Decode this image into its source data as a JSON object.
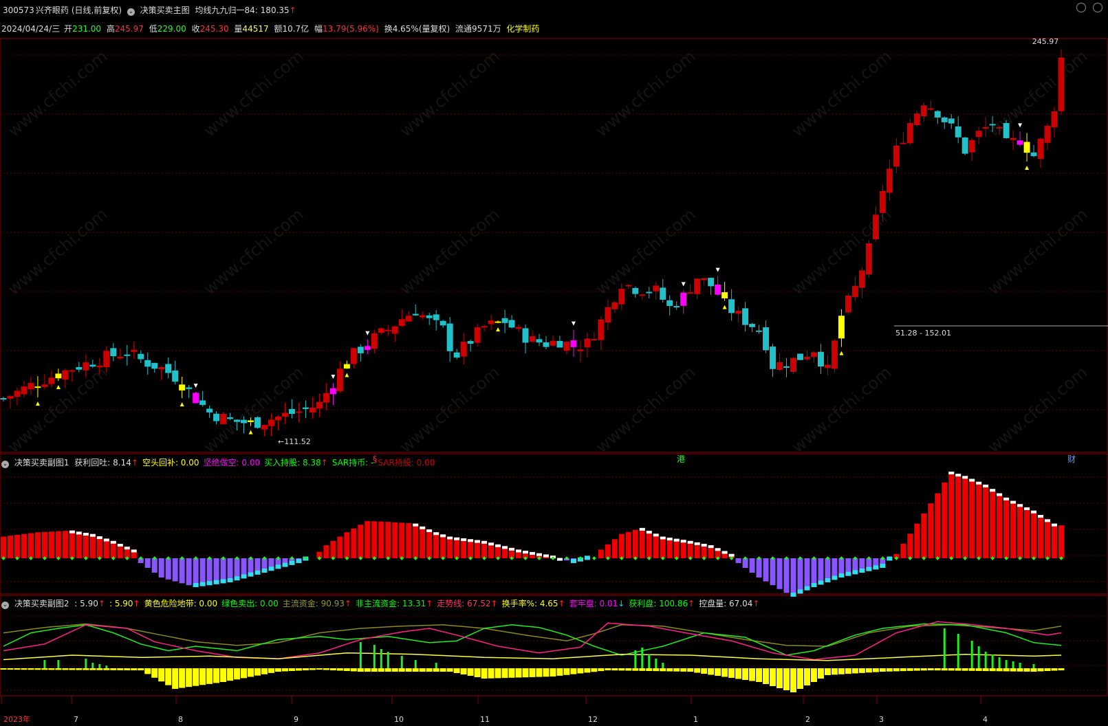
{
  "header": {
    "code": "300573",
    "name": "兴齐眼药",
    "period": "(日线,前复权)",
    "main_indicator": "决策买卖主图",
    "ma_label": "均线九九归一84:",
    "ma_value": "180.35",
    "ma_arrow": "↑"
  },
  "quote": {
    "date": "2024/04/24/三",
    "open_label": "开",
    "open": "231.00",
    "high_label": "高",
    "high": "245.97",
    "low_label": "低",
    "low": "229.00",
    "close_label": "收",
    "close": "245.30",
    "vol_label": "量",
    "vol": "44517",
    "amount_label": "额",
    "amount": "10.7亿",
    "change_label": "幅",
    "change": "13.79(5.96%)",
    "turnover": "换4.65%(量复权)",
    "float": "流通9571万",
    "sector": "化学制药"
  },
  "main_chart": {
    "high_marker": "245.97",
    "low_marker": "←111.52",
    "range_label": "51.28 - 152.01",
    "event_marks": [
      "§",
      "港",
      "财"
    ]
  },
  "sub1": {
    "title": "决策买卖副图1",
    "items": [
      {
        "label": "获利回吐: 8.14",
        "arrow": "↑",
        "color": "#dddddd"
      },
      {
        "label": "空头回补: 0.00",
        "arrow": "",
        "color": "#ffff00"
      },
      {
        "label": "坚绝做空: 0.00",
        "arrow": "",
        "color": "#ff00ff"
      },
      {
        "label": "买入持股: 8.38",
        "arrow": "↑",
        "color": "#00ff00"
      },
      {
        "label": "SAR持币: -",
        "arrow": "",
        "color": "#00ff00"
      },
      {
        "label": "SAR持股: 0.00",
        "arrow": "",
        "color": "#cc0000"
      }
    ]
  },
  "sub2": {
    "title": "决策买卖副图2",
    "items": [
      {
        "label": ": 5.90",
        "arrow": "↑",
        "color": "#dddddd"
      },
      {
        "label": ": 5.90",
        "arrow": "↑",
        "color": "#ffff00"
      },
      {
        "label": "黄色危险地带: 0.00",
        "arrow": "",
        "color": "#ffff00"
      },
      {
        "label": "绿色卖出: 0.00",
        "arrow": "",
        "color": "#00ff00"
      },
      {
        "label": "主流资金: 90.93",
        "arrow": "↑",
        "color": "#9a9a30"
      },
      {
        "label": "非主流资金: 13.31",
        "arrow": "↑",
        "color": "#00ff00"
      },
      {
        "label": "走势线: 67.52",
        "arrow": "↑",
        "color": "#ff3366"
      },
      {
        "label": "换手率%: 4.65",
        "arrow": "↑",
        "color": "#ffff00"
      },
      {
        "label": "套牢盘: 0.01",
        "arrow": "↓",
        "color": "#ff00ff"
      },
      {
        "label": "获利盘: 100.86",
        "arrow": "↑",
        "color": "#00ff00"
      },
      {
        "label": "控盘量: 67.04",
        "arrow": "↑",
        "color": "#dddddd"
      }
    ]
  },
  "x_axis_labels": [
    "2023年",
    "7",
    "8",
    "9",
    "10",
    "11",
    "12",
    "1",
    "2",
    "3",
    "4"
  ],
  "watermark": "www.cfchi.com",
  "colors": {
    "up": "#cc0000",
    "down": "#22c0c8",
    "signal_buy": "#ffff00",
    "signal_sell": "#ff00ff",
    "grid": "#6b0000",
    "hist_pos": "#ee0000",
    "hist_neg": "#8855ff",
    "hist_neg_light": "#33ddee"
  },
  "chart_data": [
    {
      "type": "candlestick",
      "title": "300573 兴齐眼药 日线 前复权",
      "price_range": [
        105,
        250
      ],
      "close_path": [
        [
          0,
          122
        ],
        [
          5,
          128
        ],
        [
          10,
          133
        ],
        [
          15,
          137
        ],
        [
          18,
          139
        ],
        [
          20,
          136
        ],
        [
          23,
          133
        ],
        [
          25,
          130
        ],
        [
          28,
          122
        ],
        [
          30,
          117
        ],
        [
          33,
          114
        ],
        [
          36,
          113
        ],
        [
          38,
          114
        ],
        [
          41,
          116
        ],
        [
          44,
          118
        ],
        [
          46,
          120
        ],
        [
          48,
          128
        ],
        [
          50,
          136
        ],
        [
          52,
          140
        ],
        [
          54,
          144
        ],
        [
          56,
          147
        ],
        [
          58,
          151
        ],
        [
          60,
          154
        ],
        [
          62,
          150
        ],
        [
          64,
          147
        ],
        [
          65,
          141
        ],
        [
          66,
          138
        ],
        [
          68,
          143
        ],
        [
          70,
          148
        ],
        [
          73,
          150
        ],
        [
          75,
          146
        ],
        [
          77,
          143
        ],
        [
          79,
          142
        ],
        [
          81,
          143
        ],
        [
          83,
          141
        ],
        [
          85,
          142
        ],
        [
          87,
          150
        ],
        [
          90,
          164
        ],
        [
          92,
          162
        ],
        [
          95,
          161
        ],
        [
          97,
          155
        ],
        [
          99,
          159
        ],
        [
          101,
          166
        ],
        [
          103,
          163
        ],
        [
          104,
          160
        ],
        [
          105,
          156
        ],
        [
          107,
          152
        ],
        [
          110,
          147
        ],
        [
          111,
          142
        ],
        [
          112,
          134
        ],
        [
          114,
          135
        ],
        [
          116,
          137
        ],
        [
          118,
          140
        ],
        [
          120,
          132
        ],
        [
          122,
          152
        ],
        [
          124,
          162
        ],
        [
          126,
          176
        ],
        [
          128,
          198
        ],
        [
          130,
          212
        ],
        [
          132,
          222
        ],
        [
          134,
          230
        ],
        [
          136,
          226
        ],
        [
          138,
          220
        ],
        [
          140,
          212
        ],
        [
          142,
          218
        ],
        [
          144,
          222
        ],
        [
          146,
          214
        ],
        [
          148,
          216
        ],
        [
          150,
          210
        ],
        [
          152,
          220
        ],
        [
          153,
          228
        ],
        [
          154,
          245.3
        ]
      ]
    },
    {
      "type": "bar",
      "title": "决策买卖副图1",
      "range": [
        -40,
        100
      ],
      "series": [
        {
          "name": "获利回吐",
          "points": [
            [
              0,
              25
            ],
            [
              5,
              30
            ],
            [
              10,
              32
            ],
            [
              13,
              28
            ],
            [
              16,
              20
            ],
            [
              19,
              10
            ],
            [
              20,
              -5
            ],
            [
              23,
              -20
            ],
            [
              28,
              -30
            ],
            [
              33,
              -25
            ],
            [
              38,
              -15
            ],
            [
              43,
              -5
            ],
            [
              45,
              0
            ],
            [
              47,
              15
            ],
            [
              50,
              30
            ],
            [
              53,
              43
            ],
            [
              56,
              42
            ],
            [
              60,
              40
            ],
            [
              63,
              30
            ],
            [
              65,
              25
            ],
            [
              70,
              20
            ],
            [
              75,
              10
            ],
            [
              80,
              3
            ],
            [
              83,
              -5
            ],
            [
              86,
              0
            ],
            [
              87,
              10
            ],
            [
              90,
              28
            ],
            [
              93,
              35
            ],
            [
              96,
              25
            ],
            [
              100,
              20
            ],
            [
              103,
              15
            ],
            [
              106,
              5
            ],
            [
              107,
              -5
            ],
            [
              110,
              -20
            ],
            [
              115,
              -40
            ],
            [
              118,
              -30
            ],
            [
              122,
              -20
            ],
            [
              128,
              -10
            ],
            [
              130,
              5
            ],
            [
              133,
              40
            ],
            [
              136,
              75
            ],
            [
              138,
              100
            ],
            [
              140,
              95
            ],
            [
              143,
              85
            ],
            [
              146,
              70
            ],
            [
              150,
              55
            ],
            [
              153,
              40
            ],
            [
              154,
              38
            ]
          ]
        }
      ]
    },
    {
      "type": "line",
      "title": "决策买卖副图2",
      "range": [
        -10,
        100
      ],
      "series": [
        {
          "name": "主流资金",
          "points": [
            [
              0,
              70
            ],
            [
              6,
              82
            ],
            [
              12,
              90
            ],
            [
              18,
              80
            ],
            [
              22,
              68
            ],
            [
              28,
              50
            ],
            [
              34,
              42
            ],
            [
              40,
              48
            ],
            [
              46,
              70
            ],
            [
              52,
              80
            ],
            [
              58,
              85
            ],
            [
              64,
              88
            ],
            [
              70,
              80
            ],
            [
              76,
              65
            ],
            [
              82,
              52
            ],
            [
              86,
              68
            ],
            [
              90,
              88
            ],
            [
              96,
              85
            ],
            [
              102,
              70
            ],
            [
              108,
              55
            ],
            [
              114,
              42
            ],
            [
              120,
              40
            ],
            [
              126,
              70
            ],
            [
              132,
              85
            ],
            [
              138,
              88
            ],
            [
              144,
              82
            ],
            [
              150,
              75
            ],
            [
              154,
              85
            ]
          ]
        },
        {
          "name": "非主流资金",
          "points": [
            [
              0,
              40
            ],
            [
              4,
              70
            ],
            [
              8,
              80
            ],
            [
              12,
              88
            ],
            [
              16,
              70
            ],
            [
              20,
              45
            ],
            [
              24,
              30
            ],
            [
              28,
              40
            ],
            [
              34,
              30
            ],
            [
              40,
              55
            ],
            [
              46,
              62
            ],
            [
              50,
              55
            ],
            [
              56,
              62
            ],
            [
              62,
              48
            ],
            [
              66,
              52
            ],
            [
              70,
              80
            ],
            [
              74,
              88
            ],
            [
              78,
              82
            ],
            [
              82,
              65
            ],
            [
              86,
              40
            ],
            [
              90,
              20
            ],
            [
              96,
              40
            ],
            [
              102,
              70
            ],
            [
              108,
              60
            ],
            [
              114,
              20
            ],
            [
              118,
              30
            ],
            [
              124,
              65
            ],
            [
              128,
              80
            ],
            [
              134,
              90
            ],
            [
              140,
              88
            ],
            [
              146,
              70
            ],
            [
              150,
              48
            ],
            [
              154,
              42
            ]
          ]
        },
        {
          "name": "走势线",
          "points": [
            [
              0,
              30
            ],
            [
              6,
              45
            ],
            [
              12,
              88
            ],
            [
              18,
              80
            ],
            [
              22,
              50
            ],
            [
              28,
              30
            ],
            [
              34,
              15
            ],
            [
              40,
              12
            ],
            [
              46,
              25
            ],
            [
              52,
              55
            ],
            [
              58,
              72
            ],
            [
              62,
              80
            ],
            [
              66,
              65
            ],
            [
              72,
              40
            ],
            [
              78,
              25
            ],
            [
              84,
              38
            ],
            [
              88,
              92
            ],
            [
              94,
              85
            ],
            [
              100,
              68
            ],
            [
              106,
              52
            ],
            [
              112,
              25
            ],
            [
              118,
              10
            ],
            [
              124,
              20
            ],
            [
              130,
              70
            ],
            [
              136,
              95
            ],
            [
              140,
              90
            ],
            [
              146,
              80
            ],
            [
              152,
              65
            ],
            [
              154,
              70
            ]
          ]
        },
        {
          "name": "控盘量",
          "points": [
            [
              0,
              10
            ],
            [
              10,
              20
            ],
            [
              20,
              15
            ],
            [
              30,
              18
            ],
            [
              40,
              12
            ],
            [
              50,
              25
            ],
            [
              60,
              22
            ],
            [
              70,
              15
            ],
            [
              80,
              12
            ],
            [
              90,
              22
            ],
            [
              100,
              20
            ],
            [
              110,
              12
            ],
            [
              120,
              8
            ],
            [
              130,
              15
            ],
            [
              140,
              22
            ],
            [
              150,
              18
            ],
            [
              154,
              20
            ]
          ]
        }
      ]
    }
  ]
}
